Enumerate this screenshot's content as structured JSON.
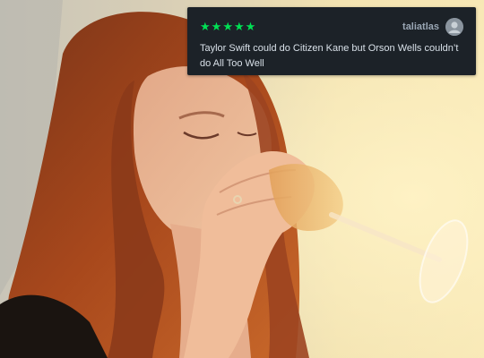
{
  "review": {
    "rating_stars": "★★★★★",
    "username": "taliatlas",
    "text": "Taylor Swift could do Citizen Kane but Orson Wells couldn’t do All Too Well",
    "star_color": "#00e054",
    "card_bg": "#1c2228"
  },
  "icons": {
    "avatar": "user-avatar-icon",
    "star": "star-icon"
  }
}
